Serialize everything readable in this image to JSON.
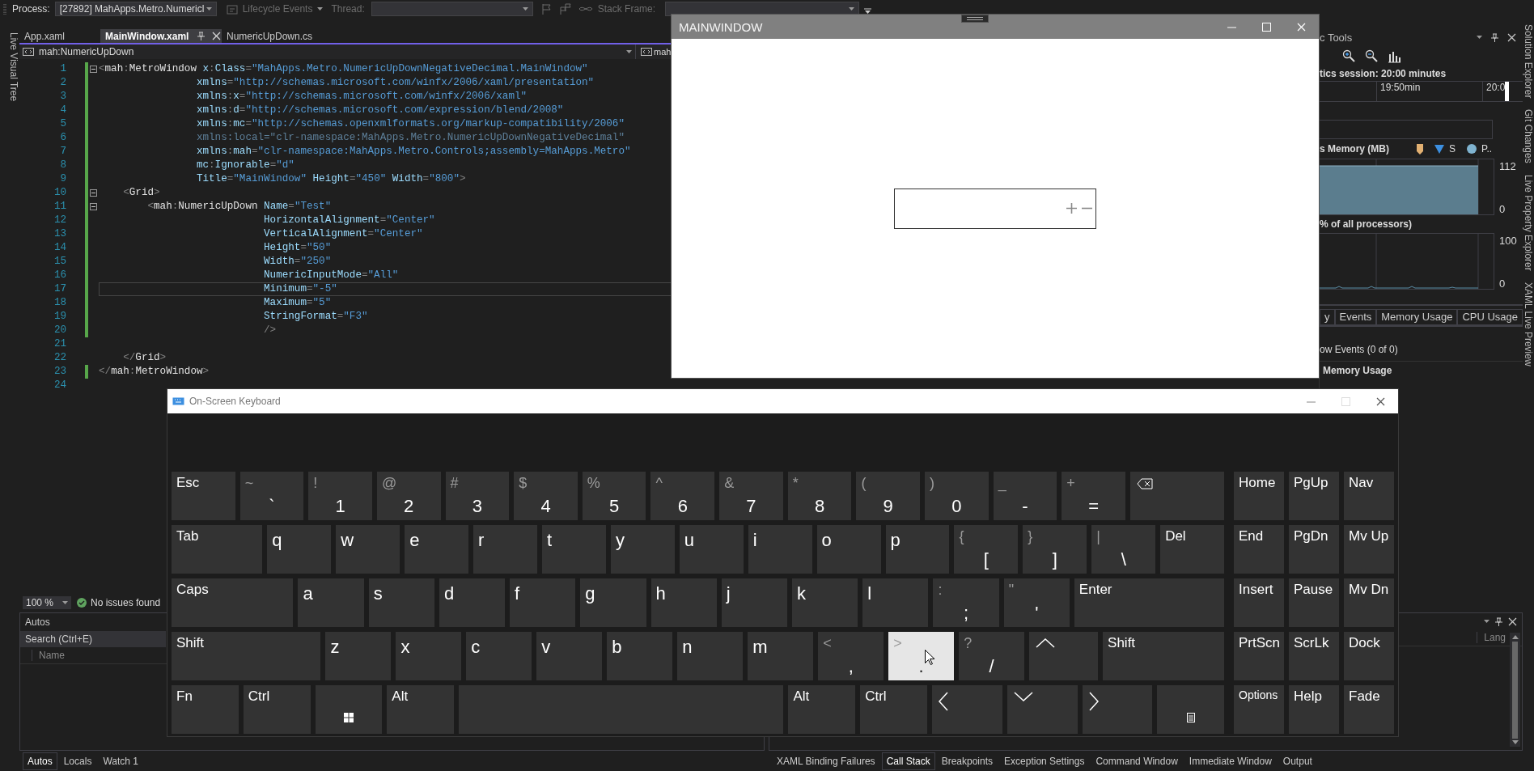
{
  "toolbar": {
    "process_label": "Process:",
    "process": "[27892] MahApps.Metro.Numericl",
    "lifecycle_events": "Lifecycle Events",
    "thread_label": "Thread:",
    "stack_frame_label": "Stack Frame:"
  },
  "left_strip": {
    "tabs": [
      "Live Visual Tree"
    ]
  },
  "right_strip": {
    "tabs": [
      "Solution Explorer",
      "Git Changes",
      "Live Property Explorer",
      "XAML Live Preview"
    ]
  },
  "editor": {
    "tabs": [
      {
        "label": "App.xaml",
        "selected": false
      },
      {
        "label": "MainWindow.xaml",
        "selected": true
      },
      {
        "label": "NumericUpDown.cs",
        "selected": false
      }
    ],
    "navigation": {
      "left": "mah:NumericUpDown",
      "right": "mah"
    },
    "lines": [
      {
        "number": "1",
        "changed": true,
        "foldable": true,
        "current": false,
        "tokens": [
          {
            "kind": "punct",
            "text": "<"
          },
          {
            "kind": "tag",
            "text": "mah"
          },
          {
            "kind": "punct",
            "text": ":"
          },
          {
            "kind": "tag",
            "text": "MetroWindow "
          },
          {
            "kind": "attr",
            "text": "x"
          },
          {
            "kind": "punct",
            "text": ":"
          },
          {
            "kind": "attr",
            "text": "Class"
          },
          {
            "kind": "punct",
            "text": "="
          },
          {
            "kind": "value",
            "text": "\"MahApps.Metro.NumericUpDownNegativeDecimal.MainWindow\""
          }
        ]
      },
      {
        "number": "2",
        "changed": true,
        "foldable": false,
        "current": false,
        "tokens": [
          {
            "kind": "attr",
            "text": "                xmlns"
          },
          {
            "kind": "punct",
            "text": "="
          },
          {
            "kind": "value",
            "text": "\"http://schemas.microsoft.com/winfx/2006/xaml/presentation\""
          }
        ]
      },
      {
        "number": "3",
        "changed": true,
        "foldable": false,
        "current": false,
        "tokens": [
          {
            "kind": "attr",
            "text": "                xmlns"
          },
          {
            "kind": "punct",
            "text": ":"
          },
          {
            "kind": "attr",
            "text": "x"
          },
          {
            "kind": "punct",
            "text": "="
          },
          {
            "kind": "value",
            "text": "\"http://schemas.microsoft.com/winfx/2006/xaml\""
          }
        ]
      },
      {
        "number": "4",
        "changed": true,
        "foldable": false,
        "current": false,
        "tokens": [
          {
            "kind": "attr",
            "text": "                xmlns"
          },
          {
            "kind": "punct",
            "text": ":"
          },
          {
            "kind": "attr",
            "text": "d"
          },
          {
            "kind": "punct",
            "text": "="
          },
          {
            "kind": "value",
            "text": "\"http://schemas.microsoft.com/expression/blend/2008\""
          }
        ]
      },
      {
        "number": "5",
        "changed": true,
        "foldable": false,
        "current": false,
        "tokens": [
          {
            "kind": "attr",
            "text": "                xmlns"
          },
          {
            "kind": "punct",
            "text": ":"
          },
          {
            "kind": "attr",
            "text": "mc"
          },
          {
            "kind": "punct",
            "text": "="
          },
          {
            "kind": "value",
            "text": "\"http://schemas.openxmlformats.org/markup-compatibility/2006\""
          }
        ]
      },
      {
        "number": "6",
        "changed": true,
        "foldable": false,
        "current": false,
        "tokens": [
          {
            "kind": "dim",
            "text": "                xmlns:local=\"clr-namespace:MahApps.Metro.NumericUpDownNegativeDecimal\""
          }
        ]
      },
      {
        "number": "7",
        "changed": true,
        "foldable": false,
        "current": false,
        "tokens": [
          {
            "kind": "attr",
            "text": "                xmlns"
          },
          {
            "kind": "punct",
            "text": ":"
          },
          {
            "kind": "attr",
            "text": "mah"
          },
          {
            "kind": "punct",
            "text": "="
          },
          {
            "kind": "value",
            "text": "\"clr-namespace:MahApps.Metro.Controls;assembly=MahApps.Metro\""
          }
        ]
      },
      {
        "number": "8",
        "changed": true,
        "foldable": false,
        "current": false,
        "tokens": [
          {
            "kind": "attr",
            "text": "                mc"
          },
          {
            "kind": "punct",
            "text": ":"
          },
          {
            "kind": "attr",
            "text": "Ignorable"
          },
          {
            "kind": "punct",
            "text": "="
          },
          {
            "kind": "value",
            "text": "\"d\""
          }
        ]
      },
      {
        "number": "9",
        "changed": true,
        "foldable": false,
        "current": false,
        "tokens": [
          {
            "kind": "attr",
            "text": "                Title"
          },
          {
            "kind": "punct",
            "text": "="
          },
          {
            "kind": "value",
            "text": "\"MainWindow\""
          },
          {
            "kind": "attr",
            "text": " Height"
          },
          {
            "kind": "punct",
            "text": "="
          },
          {
            "kind": "value",
            "text": "\"450\""
          },
          {
            "kind": "attr",
            "text": " Width"
          },
          {
            "kind": "punct",
            "text": "="
          },
          {
            "kind": "value",
            "text": "\"800\""
          },
          {
            "kind": "punct",
            "text": ">"
          }
        ]
      },
      {
        "number": "10",
        "changed": true,
        "foldable": true,
        "current": false,
        "tokens": [
          {
            "kind": "punct",
            "text": "    <"
          },
          {
            "kind": "tag",
            "text": "Grid"
          },
          {
            "kind": "punct",
            "text": ">"
          }
        ]
      },
      {
        "number": "11",
        "changed": true,
        "foldable": true,
        "current": false,
        "tokens": [
          {
            "kind": "punct",
            "text": "        <"
          },
          {
            "kind": "tag",
            "text": "mah"
          },
          {
            "kind": "punct",
            "text": ":"
          },
          {
            "kind": "tag",
            "text": "NumericUpDown "
          },
          {
            "kind": "attr",
            "text": "Name"
          },
          {
            "kind": "punct",
            "text": "="
          },
          {
            "kind": "value",
            "text": "\"Test\""
          }
        ]
      },
      {
        "number": "12",
        "changed": true,
        "foldable": false,
        "current": false,
        "tokens": [
          {
            "kind": "attr",
            "text": "                           HorizontalAlignment"
          },
          {
            "kind": "punct",
            "text": "="
          },
          {
            "kind": "value",
            "text": "\"Center\""
          }
        ]
      },
      {
        "number": "13",
        "changed": true,
        "foldable": false,
        "current": false,
        "tokens": [
          {
            "kind": "attr",
            "text": "                           VerticalAlignment"
          },
          {
            "kind": "punct",
            "text": "="
          },
          {
            "kind": "value",
            "text": "\"Center\""
          }
        ]
      },
      {
        "number": "14",
        "changed": true,
        "foldable": false,
        "current": false,
        "tokens": [
          {
            "kind": "attr",
            "text": "                           Height"
          },
          {
            "kind": "punct",
            "text": "="
          },
          {
            "kind": "value",
            "text": "\"50\""
          }
        ]
      },
      {
        "number": "15",
        "changed": true,
        "foldable": false,
        "current": false,
        "tokens": [
          {
            "kind": "attr",
            "text": "                           Width"
          },
          {
            "kind": "punct",
            "text": "="
          },
          {
            "kind": "value",
            "text": "\"250\""
          }
        ]
      },
      {
        "number": "16",
        "changed": true,
        "foldable": false,
        "current": false,
        "tokens": [
          {
            "kind": "attr",
            "text": "                           NumericInputMode"
          },
          {
            "kind": "punct",
            "text": "="
          },
          {
            "kind": "value",
            "text": "\"All\""
          }
        ]
      },
      {
        "number": "17",
        "changed": true,
        "foldable": false,
        "current": true,
        "tokens": [
          {
            "kind": "attr",
            "text": "                           Minimum"
          },
          {
            "kind": "punct",
            "text": "="
          },
          {
            "kind": "value",
            "text": "\"-5\""
          }
        ]
      },
      {
        "number": "18",
        "changed": true,
        "foldable": false,
        "current": false,
        "tokens": [
          {
            "kind": "attr",
            "text": "                           Maximum"
          },
          {
            "kind": "punct",
            "text": "="
          },
          {
            "kind": "value",
            "text": "\"5\""
          }
        ]
      },
      {
        "number": "19",
        "changed": true,
        "foldable": false,
        "current": false,
        "tokens": [
          {
            "kind": "attr",
            "text": "                           StringFormat"
          },
          {
            "kind": "punct",
            "text": "="
          },
          {
            "kind": "value",
            "text": "\"F3\""
          }
        ]
      },
      {
        "number": "20",
        "changed": true,
        "foldable": false,
        "current": false,
        "tokens": [
          {
            "kind": "punct",
            "text": "                           />"
          }
        ]
      },
      {
        "number": "21",
        "changed": false,
        "foldable": false,
        "current": false
      },
      {
        "number": "22",
        "changed": false,
        "foldable": false,
        "current": false,
        "tokens": [
          {
            "kind": "punct",
            "text": "    </"
          },
          {
            "kind": "tag",
            "text": "Grid"
          },
          {
            "kind": "punct",
            "text": ">"
          }
        ]
      },
      {
        "number": "23",
        "changed": true,
        "foldable": false,
        "current": false,
        "tokens": [
          {
            "kind": "punct",
            "text": "</"
          },
          {
            "kind": "tag",
            "text": "mah"
          },
          {
            "kind": "punct",
            "text": ":"
          },
          {
            "kind": "tag",
            "text": "MetroWindow"
          },
          {
            "kind": "punct",
            "text": ">"
          }
        ]
      },
      {
        "number": "24",
        "changed": false,
        "foldable": false,
        "current": false
      }
    ],
    "zoom": "100 %",
    "status": "No issues found"
  },
  "diagnostics": {
    "title": "c Tools",
    "session": "tics session: 20:00 minutes",
    "ruler": [
      "19:50min",
      "20:0"
    ],
    "memory_label": "s Memory (MB)",
    "legend": [
      {
        "kind": "snapshot",
        "color": "#e2b071"
      },
      {
        "kind": "triangle",
        "label": "S",
        "color": "#3c8fe0"
      },
      {
        "kind": "circle",
        "label": "P..",
        "color": "#7fb3cf"
      }
    ],
    "memory_ticks": [
      "112",
      "0"
    ],
    "cpu_label": "% of all processors)",
    "cpu_ticks": [
      "100",
      "0"
    ],
    "tabs": [
      "y",
      "Events",
      "Memory Usage",
      "CPU Usage"
    ],
    "events": "ow Events (0 of 0)",
    "section": "Memory Usage"
  },
  "main_window": {
    "title": "MAINWINDOW"
  },
  "keyboard": {
    "title": "On-Screen Keyboard",
    "main_rows": [
      [
        {
          "kind": "word",
          "label": "Esc",
          "pressed": false
        },
        {
          "kind": "dual",
          "shift": "~",
          "label": "`",
          "pressed": false
        },
        {
          "kind": "dual",
          "shift": "!",
          "label": "1",
          "pressed": false
        },
        {
          "kind": "dual",
          "shift": "@",
          "label": "2",
          "pressed": false
        },
        {
          "kind": "dual",
          "shift": "#",
          "label": "3",
          "pressed": false
        },
        {
          "kind": "dual",
          "shift": "$",
          "label": "4",
          "pressed": false
        },
        {
          "kind": "dual",
          "shift": "%",
          "label": "5",
          "pressed": false
        },
        {
          "kind": "dual",
          "shift": "^",
          "label": "6",
          "pressed": false
        },
        {
          "kind": "dual",
          "shift": "&",
          "label": "7",
          "pressed": false
        },
        {
          "kind": "dual",
          "shift": "*",
          "label": "8",
          "pressed": false
        },
        {
          "kind": "dual",
          "shift": "(",
          "label": "9",
          "pressed": false
        },
        {
          "kind": "dual",
          "shift": ")",
          "label": "0",
          "pressed": false
        },
        {
          "kind": "dual",
          "shift": "_",
          "label": "-",
          "pressed": false
        },
        {
          "kind": "dual",
          "shift": "+",
          "label": "=",
          "pressed": false
        },
        {
          "kind": "backspace",
          "pressed": false
        }
      ],
      [
        {
          "kind": "word",
          "label": "Tab",
          "pressed": false
        },
        {
          "kind": "letter",
          "label": "q",
          "pressed": false
        },
        {
          "kind": "letter",
          "label": "w",
          "pressed": false
        },
        {
          "kind": "letter",
          "label": "e",
          "pressed": false
        },
        {
          "kind": "letter",
          "label": "r",
          "pressed": false
        },
        {
          "kind": "letter",
          "label": "t",
          "pressed": false
        },
        {
          "kind": "letter",
          "label": "y",
          "pressed": false
        },
        {
          "kind": "letter",
          "label": "u",
          "pressed": false
        },
        {
          "kind": "letter",
          "label": "i",
          "pressed": false
        },
        {
          "kind": "letter",
          "label": "o",
          "pressed": false
        },
        {
          "kind": "letter",
          "label": "p",
          "pressed": false
        },
        {
          "kind": "dual",
          "shift": "{",
          "label": "[",
          "pressed": false
        },
        {
          "kind": "dual",
          "shift": "}",
          "label": "]",
          "pressed": false
        },
        {
          "kind": "dual",
          "shift": "|",
          "label": "\\",
          "pressed": false
        },
        {
          "kind": "word",
          "label": "Del",
          "pressed": false
        }
      ],
      [
        {
          "kind": "word",
          "label": "Caps",
          "pressed": false
        },
        {
          "kind": "letter",
          "label": "a",
          "pressed": false
        },
        {
          "kind": "letter",
          "label": "s",
          "pressed": false
        },
        {
          "kind": "letter",
          "label": "d",
          "pressed": false
        },
        {
          "kind": "letter",
          "label": "f",
          "pressed": false
        },
        {
          "kind": "letter",
          "label": "g",
          "pressed": false
        },
        {
          "kind": "letter",
          "label": "h",
          "pressed": false
        },
        {
          "kind": "letter",
          "label": "j",
          "pressed": false
        },
        {
          "kind": "letter",
          "label": "k",
          "pressed": false
        },
        {
          "kind": "letter",
          "label": "l",
          "pressed": false
        },
        {
          "kind": "dual",
          "shift": ":",
          "label": ";",
          "pressed": false
        },
        {
          "kind": "dual",
          "shift": "\"",
          "label": "'",
          "pressed": false
        },
        {
          "kind": "word",
          "label": "Enter",
          "pressed": false
        }
      ],
      [
        {
          "kind": "word",
          "label": "Shift",
          "pressed": false
        },
        {
          "kind": "letter",
          "label": "z",
          "pressed": false
        },
        {
          "kind": "letter",
          "label": "x",
          "pressed": false
        },
        {
          "kind": "letter",
          "label": "c",
          "pressed": false
        },
        {
          "kind": "letter",
          "label": "v",
          "pressed": false
        },
        {
          "kind": "letter",
          "label": "b",
          "pressed": false
        },
        {
          "kind": "letter",
          "label": "n",
          "pressed": false
        },
        {
          "kind": "letter",
          "label": "m",
          "pressed": false
        },
        {
          "kind": "dual",
          "shift": "<",
          "label": ",",
          "pressed": false
        },
        {
          "kind": "dual",
          "shift": ">",
          "label": ".",
          "pressed": true
        },
        {
          "kind": "dual",
          "shift": "?",
          "label": "/",
          "pressed": false
        },
        {
          "kind": "up",
          "pressed": false
        },
        {
          "kind": "word",
          "label": "Shift",
          "pressed": false
        }
      ],
      [
        {
          "kind": "word",
          "label": "Fn",
          "pressed": false
        },
        {
          "kind": "word",
          "label": "Ctrl",
          "pressed": false
        },
        {
          "kind": "windows",
          "pressed": false
        },
        {
          "kind": "word",
          "label": "Alt",
          "pressed": false
        },
        {
          "kind": "space",
          "pressed": false
        },
        {
          "kind": "word",
          "label": "Alt",
          "pressed": false
        },
        {
          "kind": "word",
          "label": "Ctrl",
          "pressed": false
        },
        {
          "kind": "left",
          "pressed": false
        },
        {
          "kind": "down",
          "pressed": false
        },
        {
          "kind": "right",
          "pressed": false
        },
        {
          "kind": "menu",
          "pressed": false
        }
      ]
    ],
    "side_rows": [
      [
        "Home",
        "PgUp",
        "Nav"
      ],
      [
        "End",
        "PgDn",
        "Mv Up"
      ],
      [
        "Insert",
        "Pause",
        "Mv Dn"
      ],
      [
        "PrtScn",
        "ScrLk",
        "Dock"
      ],
      [
        "Options",
        "Help",
        "Fade"
      ]
    ]
  },
  "autos": {
    "title": "Autos",
    "search_placeholder": "Search (Ctrl+E)",
    "columns": [
      "Name"
    ]
  },
  "call_stack": {
    "columns": [
      "Lang"
    ]
  },
  "bottom_tabs": {
    "left": [
      {
        "label": "Autos",
        "selected": true
      },
      {
        "label": "Locals",
        "selected": false
      },
      {
        "label": "Watch 1",
        "selected": false
      }
    ],
    "right": [
      {
        "label": "XAML Binding Failures",
        "selected": false
      },
      {
        "label": "Call Stack",
        "selected": true
      },
      {
        "label": "Breakpoints",
        "selected": false
      },
      {
        "label": "Exception Settings",
        "selected": false
      },
      {
        "label": "Command Window",
        "selected": false
      },
      {
        "label": "Immediate Window",
        "selected": false
      },
      {
        "label": "Output",
        "selected": false
      }
    ]
  }
}
